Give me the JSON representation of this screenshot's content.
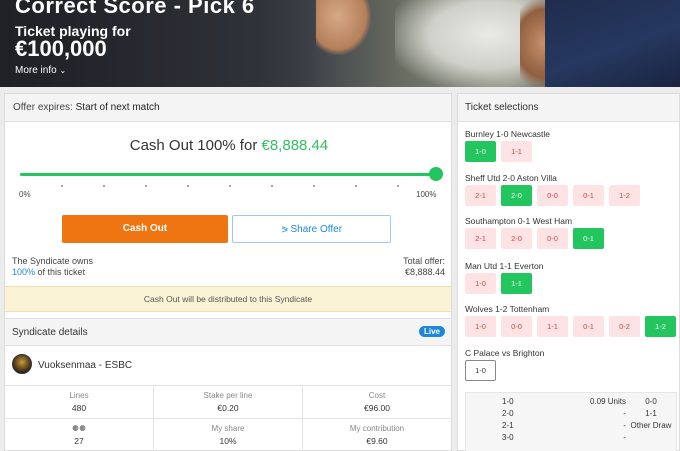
{
  "banner": {
    "title": "Correct Score - Pick 6",
    "subtitle": "Ticket playing for",
    "amount": "€100,000",
    "more_info": "More info",
    "more_icon": "chevron-down-icon"
  },
  "offer": {
    "expires_label": "Offer expires:",
    "expires_value": "Start of next match"
  },
  "cashout": {
    "title_prefix": "Cash Out 100% for",
    "amount": "€8,888.44",
    "slider_percent": 100,
    "slider_min_label": "0%",
    "slider_max_label": "100%",
    "cash_out_button": "Cash Out",
    "share_button": "Share Offer",
    "share_icon": "share-icon",
    "owns_line1": "The Syndicate owns",
    "owns_pct": "100%",
    "owns_rest": "of this ticket",
    "total_label": "Total offer:",
    "total_value": "€8,888.44",
    "notice": "Cash Out will be distributed to this Syndicate",
    "accent_color": "#22c55e",
    "button_color": "#ef7512"
  },
  "syndicate": {
    "heading": "Syndicate details",
    "live_badge": "Live",
    "name": "Vuoksenmaa - ESBC",
    "stats": [
      {
        "label": "Lines",
        "value": "480"
      },
      {
        "label": "Stake per line",
        "value": "€0.20"
      },
      {
        "label": "Cost",
        "value": "€96.00"
      },
      {
        "label": "",
        "value": "27",
        "icon": "people-icon"
      },
      {
        "label": "My share",
        "value": "10%"
      },
      {
        "label": "My contribution",
        "value": "€9.60"
      }
    ]
  },
  "selections": {
    "heading": "Ticket selections",
    "matches": [
      {
        "title": "Burnley 1-0 Newcastle",
        "chips": [
          {
            "t": "1-0",
            "s": "pick"
          },
          {
            "t": "1-1",
            "s": "no"
          }
        ]
      },
      {
        "title": "Sheff Utd 2-0 Aston Villa",
        "chips": [
          {
            "t": "2-1",
            "s": "no"
          },
          {
            "t": "2-0",
            "s": "pick"
          },
          {
            "t": "0-0",
            "s": "no"
          },
          {
            "t": "0-1",
            "s": "no"
          },
          {
            "t": "1-2",
            "s": "no"
          }
        ]
      },
      {
        "title": "Southampton 0-1 West Ham",
        "chips": [
          {
            "t": "2-1",
            "s": "no"
          },
          {
            "t": "2-0",
            "s": "no"
          },
          {
            "t": "0-0",
            "s": "no"
          },
          {
            "t": "0-1",
            "s": "pick"
          }
        ]
      },
      {
        "title": "Man Utd 1-1 Everton",
        "chips": [
          {
            "t": "1-0",
            "s": "no"
          },
          {
            "t": "1-1",
            "s": "pick"
          }
        ]
      },
      {
        "title": "Wolves 1-2 Tottenham",
        "chips": [
          {
            "t": "1-0",
            "s": "no"
          },
          {
            "t": "0-0",
            "s": "no"
          },
          {
            "t": "1-1",
            "s": "no"
          },
          {
            "t": "0-1",
            "s": "no"
          },
          {
            "t": "0-2",
            "s": "no"
          },
          {
            "t": "1-2",
            "s": "pick"
          }
        ]
      },
      {
        "title": "C Palace vs Brighton",
        "chips": [
          {
            "t": "1-0",
            "s": "open"
          }
        ]
      }
    ],
    "distribution": [
      {
        "c1": "1-0",
        "c2": "0.09 Units",
        "c3": "0-0"
      },
      {
        "c1": "2-0",
        "c2": "-",
        "c3": "1-1"
      },
      {
        "c1": "2-1",
        "c2": "-",
        "c3": "Other Draw"
      },
      {
        "c1": "3-0",
        "c2": "-",
        "c3": ""
      }
    ]
  }
}
